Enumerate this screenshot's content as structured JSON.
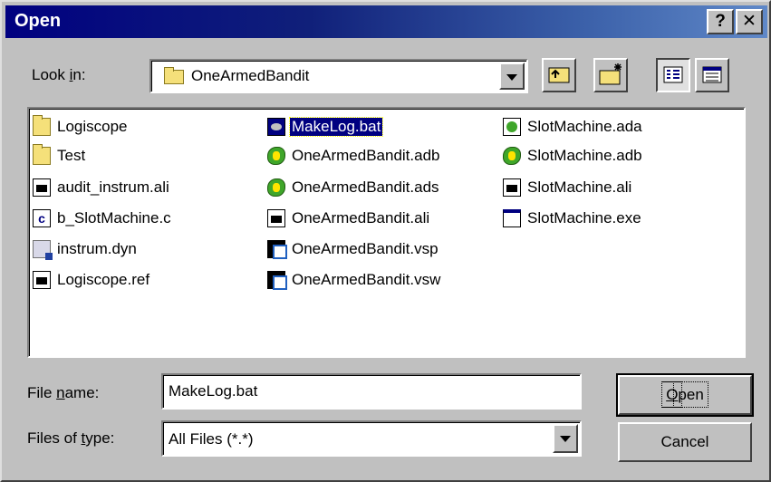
{
  "window": {
    "title": "Open",
    "help_label": "?",
    "close_label": "✕"
  },
  "look_in": {
    "label_pre": "Look ",
    "label_u": "i",
    "label_post": "n:",
    "value": "OneArmedBandit"
  },
  "toolbar": {
    "up_folder_icon": "up-one-level-icon",
    "new_folder_icon": "new-folder-icon",
    "list_view_icon": "list-view-icon",
    "details_view_icon": "details-view-icon"
  },
  "files": [
    {
      "name": "Logiscope",
      "icon": "folder-icon"
    },
    {
      "name": "Test",
      "icon": "folder-icon"
    },
    {
      "name": "audit_instrum.ali",
      "icon": "ali-file-icon"
    },
    {
      "name": "b_SlotMachine.c",
      "icon": "c-file-icon"
    },
    {
      "name": "instrum.dyn",
      "icon": "dyn-file-icon"
    },
    {
      "name": "Logiscope.ref",
      "icon": "ref-file-icon"
    },
    {
      "name": "MakeLog.bat",
      "icon": "batch-file-icon"
    },
    {
      "name": "OneArmedBandit.adb",
      "icon": "ada-body-icon"
    },
    {
      "name": "OneArmedBandit.ads",
      "icon": "ada-spec-icon"
    },
    {
      "name": "OneArmedBandit.ali",
      "icon": "ali-file-icon"
    },
    {
      "name": "OneArmedBandit.vsp",
      "icon": "vsp-file-icon"
    },
    {
      "name": "OneArmedBandit.vsw",
      "icon": "vsw-file-icon"
    },
    {
      "name": "SlotMachine.ada",
      "icon": "ada-file-icon"
    },
    {
      "name": "SlotMachine.adb",
      "icon": "ada-body-icon"
    },
    {
      "name": "SlotMachine.ali",
      "icon": "ali-file-icon"
    },
    {
      "name": "SlotMachine.exe",
      "icon": "exe-file-icon"
    }
  ],
  "selected_file": "MakeLog.bat",
  "file_name": {
    "label_pre": "File ",
    "label_u": "n",
    "label_post": "ame:",
    "value": "MakeLog.bat"
  },
  "file_type": {
    "label_pre": "Files of ",
    "label_u": "t",
    "label_post": "ype:",
    "value": "All Files (*.*)"
  },
  "buttons": {
    "open_u": "O",
    "open_rest": "pen",
    "cancel": "Cancel"
  }
}
